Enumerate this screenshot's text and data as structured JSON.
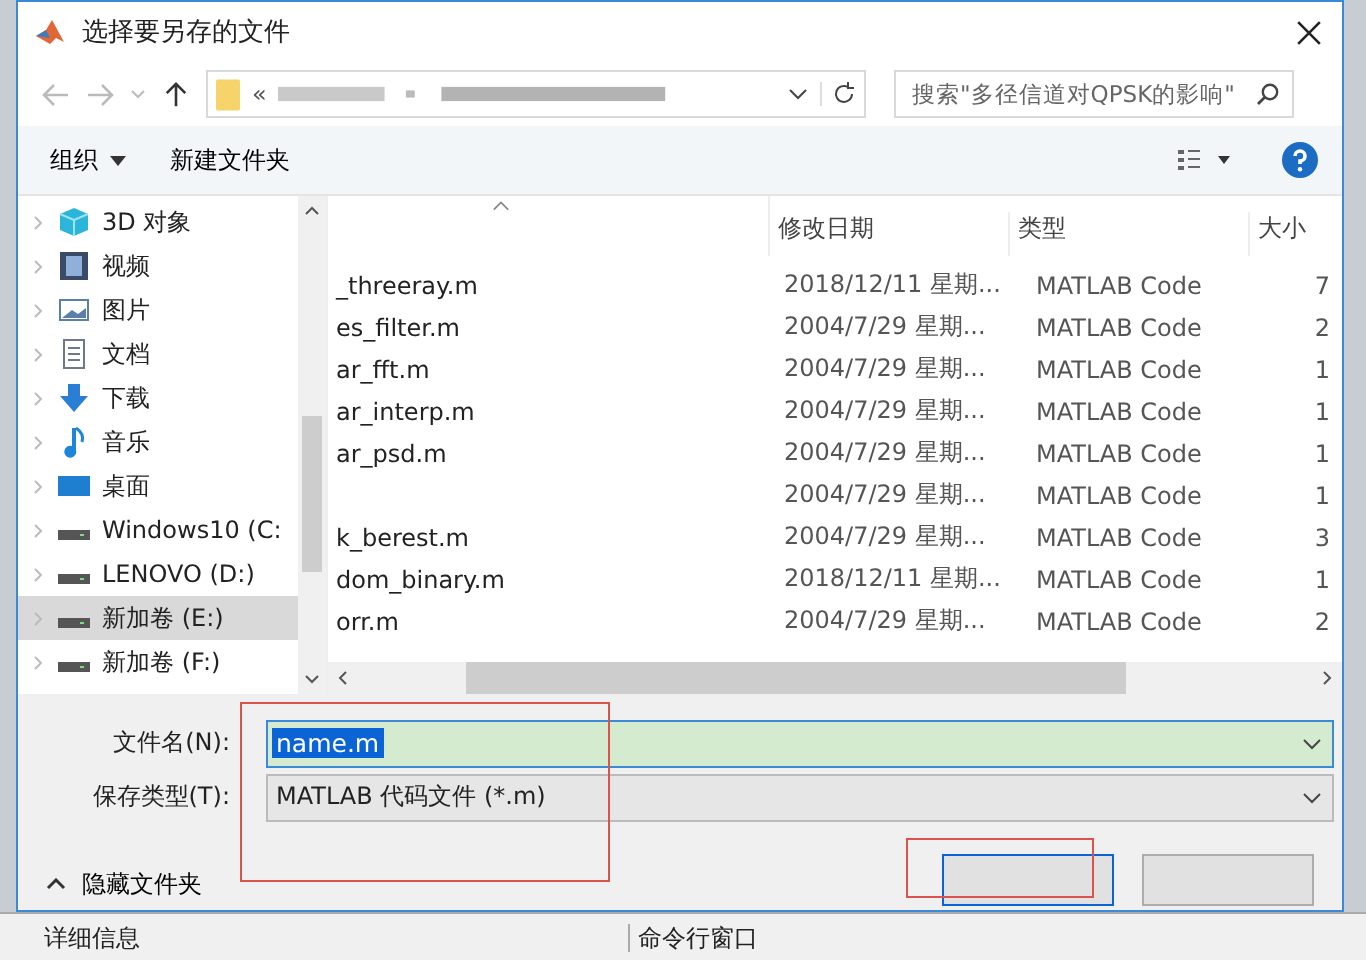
{
  "window": {
    "title": "选择要另存的文件"
  },
  "address": {
    "prefix": "«",
    "search_placeholder": "搜索\"多径信道对QPSK的影响\""
  },
  "toolbar": {
    "organize": "组织",
    "new_folder": "新建文件夹"
  },
  "sidebar": {
    "items": [
      {
        "label": "3D 对象",
        "selected": false
      },
      {
        "label": "视频",
        "selected": false
      },
      {
        "label": "图片",
        "selected": false
      },
      {
        "label": "文档",
        "selected": false
      },
      {
        "label": "下载",
        "selected": false
      },
      {
        "label": "音乐",
        "selected": false
      },
      {
        "label": "桌面",
        "selected": false
      },
      {
        "label": "Windows10 (C:",
        "selected": false
      },
      {
        "label": "LENOVO (D:)",
        "selected": false
      },
      {
        "label": "新加卷 (E:)",
        "selected": true
      },
      {
        "label": "新加卷 (F:)",
        "selected": false
      }
    ]
  },
  "table": {
    "columns": [
      "修改日期",
      "类型",
      "大小"
    ],
    "rows": [
      {
        "name": "_threeray.m",
        "date": "2018/12/11 星期...",
        "type": "MATLAB Code",
        "size": "7"
      },
      {
        "name": "es_filter.m",
        "date": "2004/7/29 星期...",
        "type": "MATLAB Code",
        "size": "2"
      },
      {
        "name": "ar_fft.m",
        "date": "2004/7/29 星期...",
        "type": "MATLAB Code",
        "size": "1"
      },
      {
        "name": "ar_interp.m",
        "date": "2004/7/29 星期...",
        "type": "MATLAB Code",
        "size": "1"
      },
      {
        "name": "ar_psd.m",
        "date": "2004/7/29 星期...",
        "type": "MATLAB Code",
        "size": "1"
      },
      {
        "date": "2004/7/29 星期...",
        "type": "MATLAB Code",
        "size": "1"
      },
      {
        "name": "k_berest.m",
        "date": "2004/7/29 星期...",
        "type": "MATLAB Code",
        "size": "3"
      },
      {
        "name": "dom_binary.m",
        "date": "2018/12/11 星期...",
        "type": "MATLAB Code",
        "size": "1"
      },
      {
        "name": "orr.m",
        "date": "2004/7/29 星期...",
        "type": "MATLAB Code",
        "size": "2"
      }
    ]
  },
  "form": {
    "filename_label": "文件名(N):",
    "filename_value": "name.m",
    "type_label": "保存类型(T):",
    "type_value": "MATLAB 代码文件 (*.m)",
    "hide_folders": "隐藏文件夹"
  },
  "background_window": {
    "panels": [
      "详细信息",
      "命令行窗口"
    ]
  }
}
